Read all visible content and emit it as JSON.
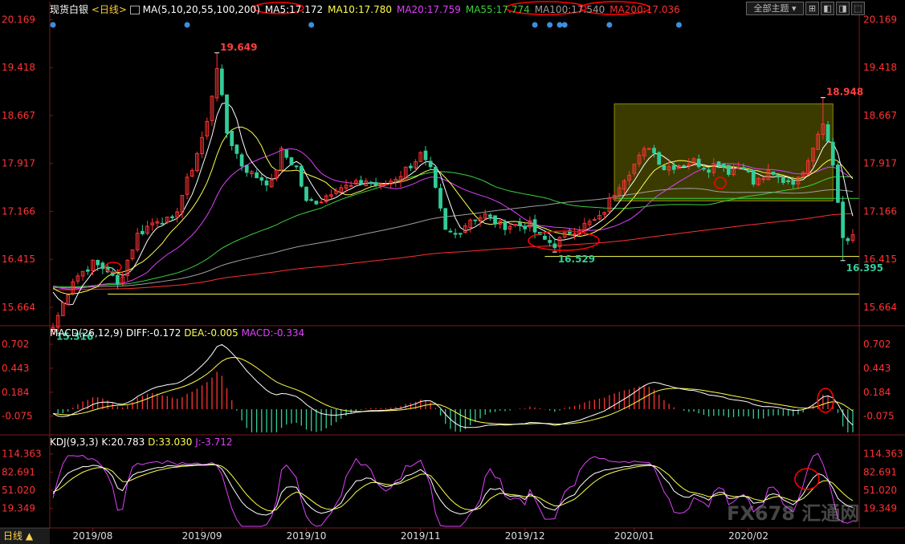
{
  "header": {
    "instrument": "现货白银",
    "period_link": "<日线>",
    "ma_label": "MA(5,10,20,55,100,200)",
    "ma_values": [
      {
        "text": "MA5:17.172",
        "color": "#ffffff"
      },
      {
        "text": "MA10:17.780",
        "color": "#ffff4d"
      },
      {
        "text": "MA20:17.759",
        "color": "#e040fb"
      },
      {
        "text": "MA55:17.774",
        "color": "#3ccf3c"
      },
      {
        "text": "MA100:17.540",
        "color": "#9e9e9e"
      },
      {
        "text": "MA200:17.036",
        "color": "#ff3030"
      }
    ],
    "theme_dropdown": "全部主题",
    "window_buttons": [
      "⊞",
      "◧",
      "◨",
      "⬚"
    ]
  },
  "macd_header": {
    "label": "MACD(26,12,9)",
    "diff": "DIFF:-0.172",
    "dea": "DEA:-0.005",
    "macd": "MACD:-0.334"
  },
  "kdj_header": {
    "label": "KDJ(9,3,3)",
    "k": "K:20.783",
    "d": "D:33.030",
    "j": "J:-3.712"
  },
  "bottom_tab": "日线 ▲",
  "watermark": "FX678 汇通网",
  "colors": {
    "up": "#ff3333",
    "down": "#33cc99",
    "ma5": "#ffffff",
    "ma10": "#ffff4d",
    "ma20": "#e040fb",
    "ma55": "#3ccf3c",
    "ma100": "#9e9e9e",
    "ma200": "#ff3030",
    "axis": "#ff3333",
    "annotation": "#ff0000",
    "box": "#6b6b00"
  },
  "chart_data": [
    {
      "type": "candlestick",
      "yticks": [
        20.169,
        19.418,
        18.667,
        17.917,
        17.166,
        16.415,
        15.664
      ],
      "ylim": [
        15.4,
        20.25
      ],
      "xticks": [
        "2019/08",
        "2019/09",
        "2019/10",
        "2019/11",
        "2019/12",
        "2020/01",
        "2020/02"
      ],
      "price_labels": [
        {
          "text": "19.649",
          "value": 19.649,
          "kind": "high"
        },
        {
          "text": "18.948",
          "value": 18.948,
          "kind": "high"
        },
        {
          "text": "16.529",
          "value": 16.529,
          "kind": "low"
        },
        {
          "text": "16.395",
          "value": 16.395,
          "kind": "low"
        },
        {
          "text": "15.316",
          "value": 15.316,
          "kind": "low"
        }
      ],
      "horizontal_lines": [
        16.46,
        15.87,
        17.37
      ],
      "close_anchors": [
        [
          "2019-07-22",
          15.35
        ],
        [
          "2019-07-26",
          16.1
        ],
        [
          "2019-08-01",
          16.35
        ],
        [
          "2019-08-06",
          16.25
        ],
        [
          "2019-08-08",
          16.0
        ],
        [
          "2019-08-14",
          16.8
        ],
        [
          "2019-08-20",
          17.05
        ],
        [
          "2019-08-23",
          17.0
        ],
        [
          "2019-08-29",
          17.85
        ],
        [
          "2019-09-03",
          18.55
        ],
        [
          "2019-09-05",
          19.45
        ],
        [
          "2019-09-09",
          18.4
        ],
        [
          "2019-09-12",
          17.9
        ],
        [
          "2019-09-16",
          17.75
        ],
        [
          "2019-09-20",
          17.6
        ],
        [
          "2019-09-24",
          18.1
        ],
        [
          "2019-09-27",
          17.85
        ],
        [
          "2019-10-01",
          17.3
        ],
        [
          "2019-10-04",
          17.35
        ],
        [
          "2019-10-09",
          17.55
        ],
        [
          "2019-10-14",
          17.55
        ],
        [
          "2019-10-17",
          17.65
        ],
        [
          "2019-10-22",
          17.55
        ],
        [
          "2019-10-28",
          17.75
        ],
        [
          "2019-11-01",
          18.05
        ],
        [
          "2019-11-05",
          17.8
        ],
        [
          "2019-11-08",
          16.85
        ],
        [
          "2019-11-12",
          16.8
        ],
        [
          "2019-11-15",
          17.05
        ],
        [
          "2019-11-20",
          17.1
        ],
        [
          "2019-11-25",
          16.95
        ],
        [
          "2019-11-29",
          16.95
        ],
        [
          "2019-12-03",
          16.95
        ],
        [
          "2019-12-05",
          16.75
        ],
        [
          "2019-12-10",
          16.65
        ],
        [
          "2019-12-13",
          16.85
        ],
        [
          "2019-12-18",
          16.95
        ],
        [
          "2019-12-23",
          17.05
        ],
        [
          "2019-12-27",
          17.6
        ],
        [
          "2019-12-31",
          17.8
        ],
        [
          "2020-01-06",
          18.2
        ],
        [
          "2020-01-09",
          17.85
        ],
        [
          "2020-01-14",
          17.9
        ],
        [
          "2020-01-17",
          17.95
        ],
        [
          "2020-01-22",
          17.85
        ],
        [
          "2020-01-24",
          17.95
        ],
        [
          "2020-01-28",
          17.8
        ],
        [
          "2020-01-31",
          17.9
        ],
        [
          "2020-02-04",
          17.6
        ],
        [
          "2020-02-07",
          17.75
        ],
        [
          "2020-02-12",
          17.65
        ],
        [
          "2020-02-17",
          17.65
        ],
        [
          "2020-02-20",
          18.2
        ],
        [
          "2020-02-24",
          18.6
        ],
        [
          "2020-02-26",
          17.9
        ],
        [
          "2020-02-28",
          16.75
        ],
        [
          "2020-03-02",
          16.65
        ],
        [
          "2020-03-03",
          16.8
        ]
      ]
    },
    {
      "type": "macd",
      "yticks": [
        0.702,
        0.443,
        0.184,
        -0.075
      ],
      "ylim": [
        -0.26,
        0.78
      ],
      "diff": -0.172,
      "dea": -0.005,
      "macd": -0.334
    },
    {
      "type": "kdj",
      "yticks": [
        114.363,
        82.691,
        51.02,
        19.349
      ],
      "ylim": [
        -12,
        128
      ],
      "k": 20.783,
      "d": 33.03,
      "j": -3.712
    }
  ]
}
